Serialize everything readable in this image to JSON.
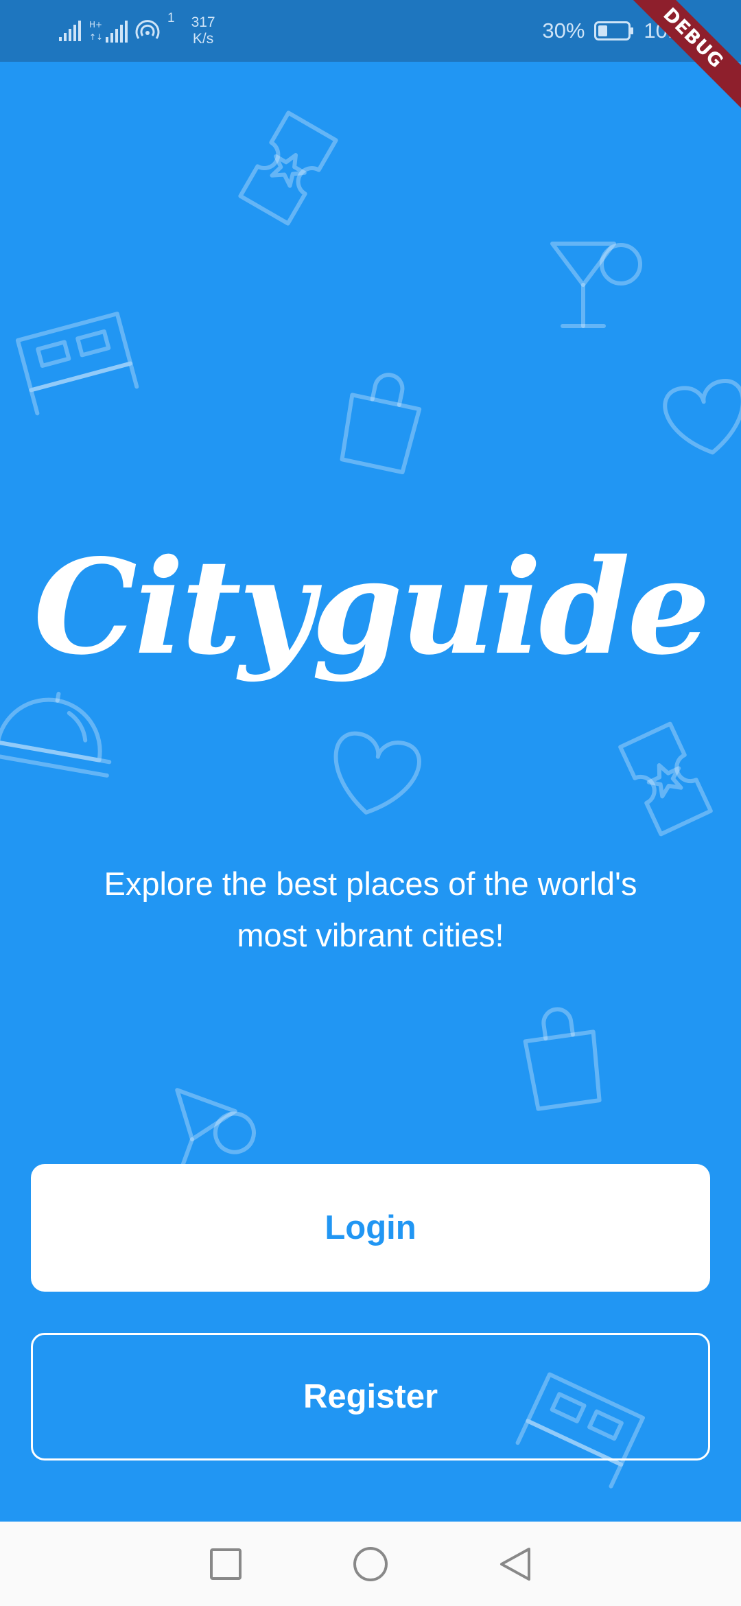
{
  "status_bar": {
    "net_count": "1",
    "speed_value": "317",
    "speed_unit": "K/s",
    "battery": "30%",
    "time": "10:02",
    "debug_label": "DEBUG"
  },
  "app": {
    "logo": "Cityguide",
    "tagline_line1": "Explore the best places of the world's",
    "tagline_line2": "most vibrant cities!",
    "login_label": "Login",
    "register_label": "Register"
  },
  "colors": {
    "primary": "#2196F3",
    "status_bar": "#1E76BF",
    "debug_ribbon": "#8e1f2c",
    "nav_bar": "#fafafa"
  },
  "icons": [
    "signal-icon",
    "signal-hplus-icon",
    "hotspot-icon",
    "battery-icon",
    "ticket-icon",
    "cocktail-icon",
    "bed-icon",
    "shopping-bag-icon",
    "heart-icon",
    "cloche-icon",
    "square-nav-icon",
    "circle-nav-icon",
    "back-nav-icon"
  ]
}
